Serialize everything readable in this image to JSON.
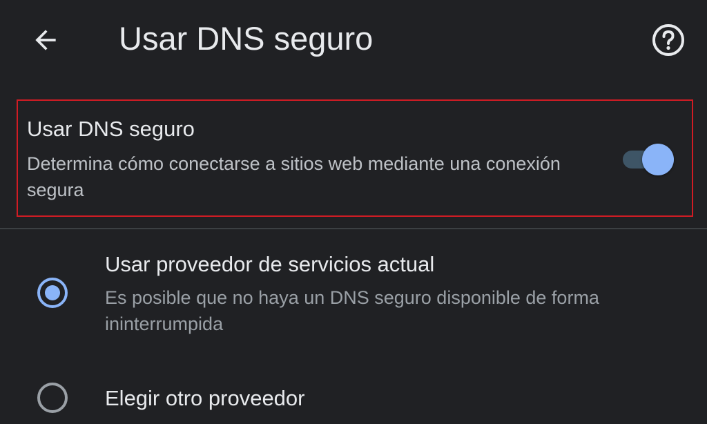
{
  "header": {
    "title": "Usar DNS seguro",
    "back_icon": "arrow-back-icon",
    "help_icon": "help-circle-icon"
  },
  "secure_dns_toggle": {
    "title": "Usar DNS seguro",
    "summary": "Determina cómo conectarse a sitios web mediante una conexión segura",
    "enabled": true
  },
  "options": [
    {
      "title": "Usar proveedor de servicios actual",
      "summary": "Es posible que no haya un DNS seguro disponible de forma ininterrumpida",
      "selected": true
    },
    {
      "title": "Elegir otro proveedor",
      "selected": false
    }
  ],
  "colors": {
    "background": "#202124",
    "accent": "#8ab4f8",
    "highlight_border": "#d01c24",
    "text_primary": "#e8eaed",
    "text_secondary": "#9aa0a6"
  }
}
